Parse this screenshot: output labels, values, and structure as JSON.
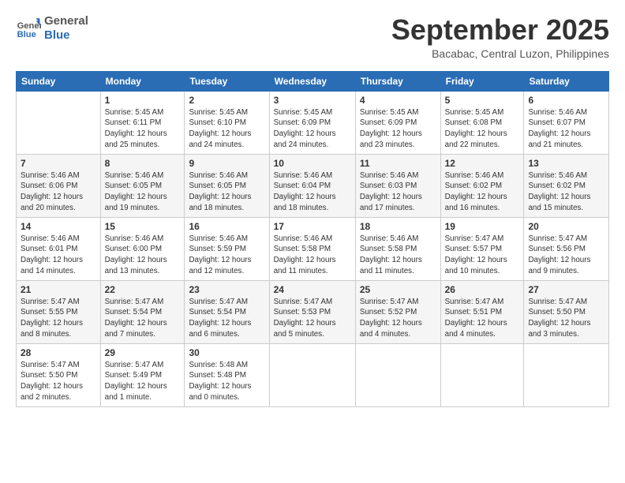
{
  "header": {
    "logo_line1": "General",
    "logo_line2": "Blue",
    "month": "September 2025",
    "location": "Bacabac, Central Luzon, Philippines"
  },
  "days_of_week": [
    "Sunday",
    "Monday",
    "Tuesday",
    "Wednesday",
    "Thursday",
    "Friday",
    "Saturday"
  ],
  "weeks": [
    [
      {
        "day": "",
        "info": ""
      },
      {
        "day": "1",
        "info": "Sunrise: 5:45 AM\nSunset: 6:11 PM\nDaylight: 12 hours\nand 25 minutes."
      },
      {
        "day": "2",
        "info": "Sunrise: 5:45 AM\nSunset: 6:10 PM\nDaylight: 12 hours\nand 24 minutes."
      },
      {
        "day": "3",
        "info": "Sunrise: 5:45 AM\nSunset: 6:09 PM\nDaylight: 12 hours\nand 24 minutes."
      },
      {
        "day": "4",
        "info": "Sunrise: 5:45 AM\nSunset: 6:09 PM\nDaylight: 12 hours\nand 23 minutes."
      },
      {
        "day": "5",
        "info": "Sunrise: 5:45 AM\nSunset: 6:08 PM\nDaylight: 12 hours\nand 22 minutes."
      },
      {
        "day": "6",
        "info": "Sunrise: 5:46 AM\nSunset: 6:07 PM\nDaylight: 12 hours\nand 21 minutes."
      }
    ],
    [
      {
        "day": "7",
        "info": "Sunrise: 5:46 AM\nSunset: 6:06 PM\nDaylight: 12 hours\nand 20 minutes."
      },
      {
        "day": "8",
        "info": "Sunrise: 5:46 AM\nSunset: 6:05 PM\nDaylight: 12 hours\nand 19 minutes."
      },
      {
        "day": "9",
        "info": "Sunrise: 5:46 AM\nSunset: 6:05 PM\nDaylight: 12 hours\nand 18 minutes."
      },
      {
        "day": "10",
        "info": "Sunrise: 5:46 AM\nSunset: 6:04 PM\nDaylight: 12 hours\nand 18 minutes."
      },
      {
        "day": "11",
        "info": "Sunrise: 5:46 AM\nSunset: 6:03 PM\nDaylight: 12 hours\nand 17 minutes."
      },
      {
        "day": "12",
        "info": "Sunrise: 5:46 AM\nSunset: 6:02 PM\nDaylight: 12 hours\nand 16 minutes."
      },
      {
        "day": "13",
        "info": "Sunrise: 5:46 AM\nSunset: 6:02 PM\nDaylight: 12 hours\nand 15 minutes."
      }
    ],
    [
      {
        "day": "14",
        "info": "Sunrise: 5:46 AM\nSunset: 6:01 PM\nDaylight: 12 hours\nand 14 minutes."
      },
      {
        "day": "15",
        "info": "Sunrise: 5:46 AM\nSunset: 6:00 PM\nDaylight: 12 hours\nand 13 minutes."
      },
      {
        "day": "16",
        "info": "Sunrise: 5:46 AM\nSunset: 5:59 PM\nDaylight: 12 hours\nand 12 minutes."
      },
      {
        "day": "17",
        "info": "Sunrise: 5:46 AM\nSunset: 5:58 PM\nDaylight: 12 hours\nand 11 minutes."
      },
      {
        "day": "18",
        "info": "Sunrise: 5:46 AM\nSunset: 5:58 PM\nDaylight: 12 hours\nand 11 minutes."
      },
      {
        "day": "19",
        "info": "Sunrise: 5:47 AM\nSunset: 5:57 PM\nDaylight: 12 hours\nand 10 minutes."
      },
      {
        "day": "20",
        "info": "Sunrise: 5:47 AM\nSunset: 5:56 PM\nDaylight: 12 hours\nand 9 minutes."
      }
    ],
    [
      {
        "day": "21",
        "info": "Sunrise: 5:47 AM\nSunset: 5:55 PM\nDaylight: 12 hours\nand 8 minutes."
      },
      {
        "day": "22",
        "info": "Sunrise: 5:47 AM\nSunset: 5:54 PM\nDaylight: 12 hours\nand 7 minutes."
      },
      {
        "day": "23",
        "info": "Sunrise: 5:47 AM\nSunset: 5:54 PM\nDaylight: 12 hours\nand 6 minutes."
      },
      {
        "day": "24",
        "info": "Sunrise: 5:47 AM\nSunset: 5:53 PM\nDaylight: 12 hours\nand 5 minutes."
      },
      {
        "day": "25",
        "info": "Sunrise: 5:47 AM\nSunset: 5:52 PM\nDaylight: 12 hours\nand 4 minutes."
      },
      {
        "day": "26",
        "info": "Sunrise: 5:47 AM\nSunset: 5:51 PM\nDaylight: 12 hours\nand 4 minutes."
      },
      {
        "day": "27",
        "info": "Sunrise: 5:47 AM\nSunset: 5:50 PM\nDaylight: 12 hours\nand 3 minutes."
      }
    ],
    [
      {
        "day": "28",
        "info": "Sunrise: 5:47 AM\nSunset: 5:50 PM\nDaylight: 12 hours\nand 2 minutes."
      },
      {
        "day": "29",
        "info": "Sunrise: 5:47 AM\nSunset: 5:49 PM\nDaylight: 12 hours\nand 1 minute."
      },
      {
        "day": "30",
        "info": "Sunrise: 5:48 AM\nSunset: 5:48 PM\nDaylight: 12 hours\nand 0 minutes."
      },
      {
        "day": "",
        "info": ""
      },
      {
        "day": "",
        "info": ""
      },
      {
        "day": "",
        "info": ""
      },
      {
        "day": "",
        "info": ""
      }
    ]
  ]
}
